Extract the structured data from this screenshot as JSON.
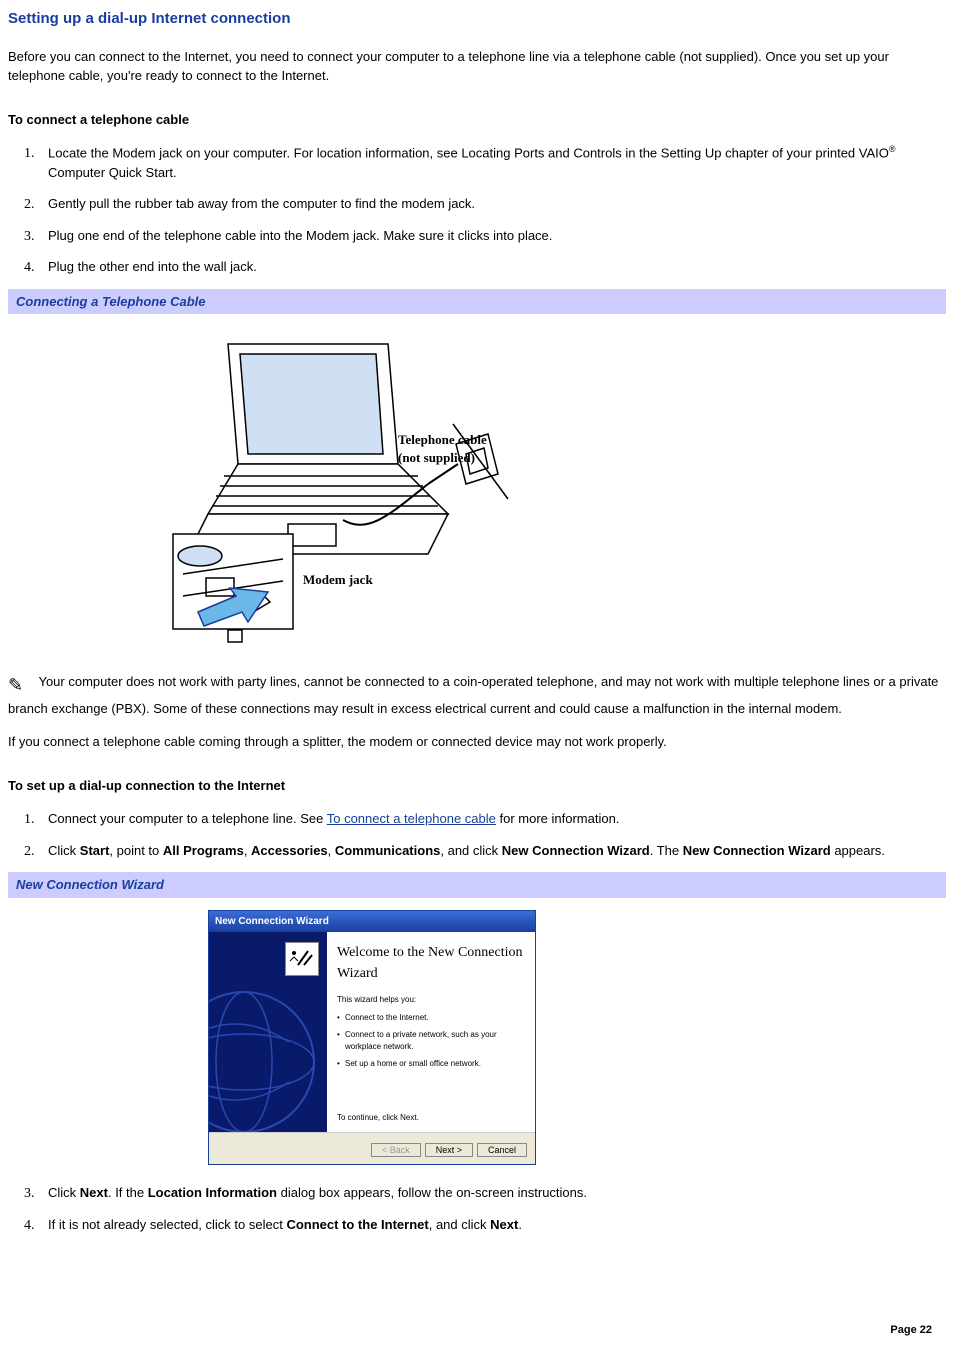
{
  "title": "Setting up a dial-up Internet connection",
  "intro": "Before you can connect to the Internet, you need to connect your computer to a telephone line via a telephone cable (not supplied). Once you set up your telephone cable, you're ready to connect to the Internet.",
  "sub1_title": "To connect a telephone cable",
  "sub1_items": {
    "i1a": "Locate the Modem jack on your computer. For location information, see Locating Ports and Controls in the Setting Up chapter of your printed VAIO",
    "i1_reg": "®",
    "i1b": " Computer Quick Start.",
    "i2": "Gently pull the rubber tab away from the computer to find the modem jack.",
    "i3": "Plug one end of the telephone cable into the Modem jack. Make sure it clicks into place.",
    "i4": "Plug the other end into the wall jack."
  },
  "caption1": "Connecting a Telephone Cable",
  "diagram": {
    "cable_label": "Telephone cable",
    "not_supplied": "(not supplied)",
    "modem_label": "Modem jack"
  },
  "note1": " Your computer does not work with party lines, cannot be connected to a coin-operated telephone, and may not work with multiple telephone lines or a private branch exchange (PBX). Some of these connections may result in excess electrical current and could cause a malfunction in the internal modem.",
  "note2": "If you connect a telephone cable coming through a splitter, the modem or connected device may not work properly.",
  "sub2_title": "To set up a dial-up connection to the Internet",
  "sub2_items": {
    "i1a": "Connect your computer to a telephone line. See ",
    "i1_link": "To connect a telephone cable",
    "i1b": " for more information.",
    "i2a": "Click ",
    "i2_start": "Start",
    "i2b": ", point to ",
    "i2_allprog": "All Programs",
    "i2c": ", ",
    "i2_acc": "Accessories",
    "i2d": ", ",
    "i2_comm": "Communications",
    "i2e": ", and click ",
    "i2_ncw": "New Connection Wizard",
    "i2f": ". The ",
    "i2_ncw2": "New Connection Wizard",
    "i2g": " appears.",
    "i3a": "Click ",
    "i3_next": "Next",
    "i3b": ". If the ",
    "i3_loc": "Location Information",
    "i3c": " dialog box appears, follow the on-screen instructions.",
    "i4a": "If it is not already selected, click to select ",
    "i4_conn": "Connect to the Internet",
    "i4b": ", and click ",
    "i4_next": "Next",
    "i4c": "."
  },
  "caption2": "New Connection Wizard",
  "wizard": {
    "titlebar": "New Connection Wizard",
    "welcome": "Welcome to the New Connection Wizard",
    "line1": "This wizard helps you:",
    "b1": "Connect to the Internet.",
    "b2": "Connect to a private network, such as your workplace network.",
    "b3": "Set up a home or small office network.",
    "continue": "To continue, click Next.",
    "back": "< Back",
    "next": "Next >",
    "cancel": "Cancel"
  },
  "page_number": "Page 22"
}
